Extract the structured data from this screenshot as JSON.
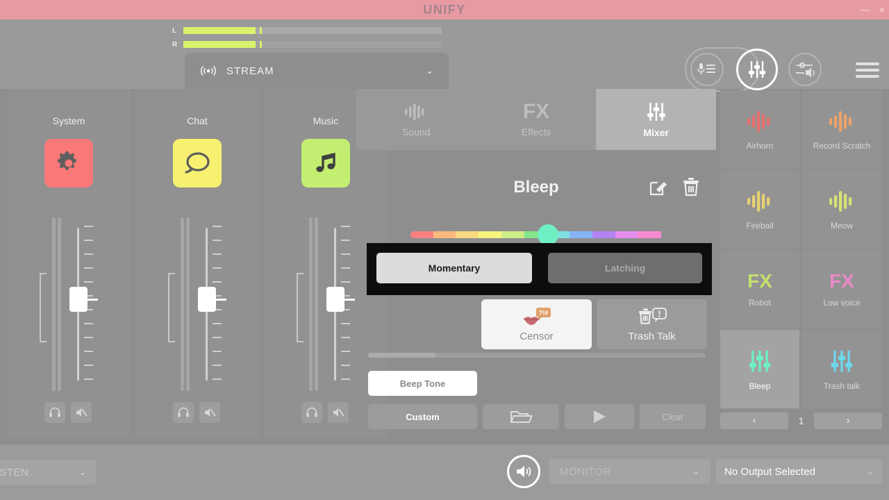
{
  "window": {
    "title": "UNIFY",
    "minimize_label": "—",
    "close_label": "×",
    "titlebar_color": "#e89aa3"
  },
  "meters": {
    "left_label": "L",
    "right_label": "R",
    "left_level_pct": 28,
    "right_level_pct": 28,
    "peak_color": "#d9f26b"
  },
  "topicons": {
    "mic_list_icon": "mic-list-icon",
    "mixer_icon": "mixer-sliders-icon",
    "volume_icon": "volume-slider-icon",
    "menu_icon": "hamburger-menu-icon"
  },
  "stream_tab": {
    "icon": "broadcast-icon",
    "label": "STREAM",
    "chevron": "⌄"
  },
  "channels": [
    {
      "name": "System",
      "icon": "gear-icon",
      "icon_color": "#fa7878",
      "fader_pct": 62,
      "monitor_icon": "headphone-icon",
      "mute_icon": "mute-icon"
    },
    {
      "name": "Chat",
      "icon": "chat-bubble-icon",
      "icon_color": "#f7f170",
      "fader_pct": 62,
      "monitor_icon": "headphone-icon",
      "mute_icon": "mute-icon"
    },
    {
      "name": "Music",
      "icon": "music-note-icon",
      "icon_color": "#c4ee72",
      "fader_pct": 62,
      "monitor_icon": "headphone-icon",
      "mute_icon": "mute-icon"
    }
  ],
  "center": {
    "tabs": [
      {
        "label": "Sound",
        "icon": "waveform-icon",
        "active": false
      },
      {
        "label": "Effects",
        "icon": "fx-text-icon",
        "fx_text": "FX",
        "active": false
      },
      {
        "label": "Mixer",
        "icon": "mixer-sliders-icon",
        "active": true
      }
    ],
    "sound_name": "Bleep",
    "edit_icon": "edit-pencil-icon",
    "delete_icon": "trash-icon",
    "color_slider": {
      "segments": [
        "#f98080",
        "#f9b87e",
        "#f9d980",
        "#f7f47e",
        "#cdee85",
        "#86e58c",
        "#7fe0e4",
        "#86b5f6",
        "#b383f4",
        "#e68ef2",
        "#f98ad0"
      ],
      "handle_color": "#6ef0c4",
      "handle_position_pct": 55
    },
    "mode_buttons": [
      {
        "label": "Momentary",
        "selected": true
      },
      {
        "label": "Latching",
        "selected": false
      }
    ],
    "type_buttons": [
      {
        "label": "Censor",
        "icon": "censor-lips-icon",
        "selected": true
      },
      {
        "label": "Trash Talk",
        "icon": "trash-alert-icon",
        "selected": false
      }
    ],
    "scrollbar_pct": 20,
    "source_buttons": [
      {
        "label": "Beep Tone",
        "selected": true
      },
      {
        "label": "Custom",
        "selected": false
      },
      {
        "label": "",
        "icon": "folder-icon",
        "selected": false
      },
      {
        "label": "",
        "icon": "play-icon",
        "selected": false
      },
      {
        "label": "Clear",
        "selected": false
      }
    ]
  },
  "pads": [
    {
      "label": "Airhorn",
      "icon": "waveform-icon",
      "color": "#e8706e",
      "selected": false
    },
    {
      "label": "Record Scratch",
      "icon": "waveform-icon",
      "color": "#eda26a",
      "selected": false
    },
    {
      "label": "Fireball",
      "icon": "waveform-icon",
      "color": "#e8d172",
      "selected": false
    },
    {
      "label": "Meow",
      "icon": "waveform-icon",
      "color": "#d8e273",
      "selected": false
    },
    {
      "label": "Robot",
      "icon": "fx-text-icon",
      "fx_text": "FX",
      "color": "#c4e06d",
      "selected": false
    },
    {
      "label": "Low voice",
      "icon": "fx-text-icon",
      "fx_text": "FX",
      "color": "#ec8ac9",
      "selected": false
    },
    {
      "label": "Bleep",
      "icon": "mixer-sliders-icon",
      "color": "#6ef0c4",
      "selected": true
    },
    {
      "label": "Trash talk",
      "icon": "mixer-sliders-icon",
      "color": "#6fd8ec",
      "selected": false
    }
  ],
  "pager": {
    "prev_label": "‹",
    "next_label": "›",
    "page": "1"
  },
  "bottom": {
    "listen_label": "LISTEN",
    "speaker_icon": "speaker-icon",
    "monitor_label": "MONITOR",
    "output_label": "No Output Selected",
    "chevron": "⌄"
  }
}
